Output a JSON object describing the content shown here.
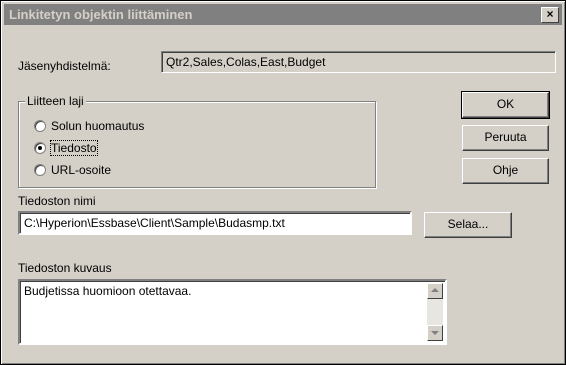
{
  "window": {
    "title": "Linkitetyn objektin liittäminen",
    "close_symbol": "×"
  },
  "member_combination": {
    "label": "Jäsenyhdistelmä:",
    "value": "Qtr2,Sales,Colas,East,Budget"
  },
  "attachment_type": {
    "legend": "Liitteen laji",
    "options": [
      {
        "label": "Solun huomautus",
        "selected": false
      },
      {
        "label": "Tiedosto",
        "selected": true
      },
      {
        "label": "URL-osoite",
        "selected": false
      }
    ]
  },
  "buttons": {
    "ok": "OK",
    "cancel": "Peruuta",
    "help": "Ohje",
    "browse": "Selaa..."
  },
  "file_name": {
    "label": "Tiedoston nimi",
    "value": "C:\\Hyperion\\Essbase\\Client\\Sample\\Budasmp.txt"
  },
  "file_description": {
    "label": "Tiedoston kuvaus",
    "value": "Budjetissa huomioon otettavaa."
  }
}
